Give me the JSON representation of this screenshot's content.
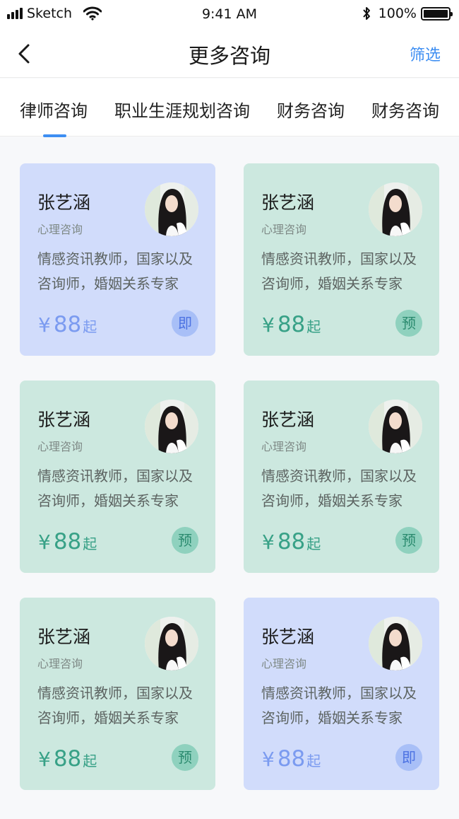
{
  "status_bar": {
    "carrier": "Sketch",
    "time": "9:41 AM",
    "battery": "100%"
  },
  "nav": {
    "title": "更多咨询",
    "filter_label": "筛选"
  },
  "tabs": [
    {
      "label": "律师咨询",
      "active": true
    },
    {
      "label": "职业生涯规划咨询",
      "active": false
    },
    {
      "label": "财务咨询",
      "active": false
    },
    {
      "label": "财务咨询",
      "active": false
    }
  ],
  "colors": {
    "accent": "#3d8ef2",
    "card_blue": "#d1dcfb",
    "card_green": "#cce8df"
  },
  "cards": [
    {
      "name": "张艺涵",
      "category": "心理咨询",
      "desc_line1": "情感资讯教师，国家以及",
      "desc_line2": "咨询师，婚姻关系专家",
      "currency": "¥",
      "price": "88",
      "price_suffix": "起",
      "badge": "即",
      "theme": "blue"
    },
    {
      "name": "张艺涵",
      "category": "心理咨询",
      "desc_line1": "情感资讯教师，国家以及",
      "desc_line2": "咨询师，婚姻关系专家",
      "currency": "¥",
      "price": "88",
      "price_suffix": "起",
      "badge": "预",
      "theme": "green"
    },
    {
      "name": "张艺涵",
      "category": "心理咨询",
      "desc_line1": "情感资讯教师，国家以及",
      "desc_line2": "咨询师，婚姻关系专家",
      "currency": "¥",
      "price": "88",
      "price_suffix": "起",
      "badge": "预",
      "theme": "green"
    },
    {
      "name": "张艺涵",
      "category": "心理咨询",
      "desc_line1": "情感资讯教师，国家以及",
      "desc_line2": "咨询师，婚姻关系专家",
      "currency": "¥",
      "price": "88",
      "price_suffix": "起",
      "badge": "预",
      "theme": "green"
    },
    {
      "name": "张艺涵",
      "category": "心理咨询",
      "desc_line1": "情感资讯教师，国家以及",
      "desc_line2": "咨询师，婚姻关系专家",
      "currency": "¥",
      "price": "88",
      "price_suffix": "起",
      "badge": "预",
      "theme": "green"
    },
    {
      "name": "张艺涵",
      "category": "心理咨询",
      "desc_line1": "情感资讯教师，国家以及",
      "desc_line2": "咨询师，婚姻关系专家",
      "currency": "¥",
      "price": "88",
      "price_suffix": "起",
      "badge": "即",
      "theme": "blue"
    }
  ]
}
